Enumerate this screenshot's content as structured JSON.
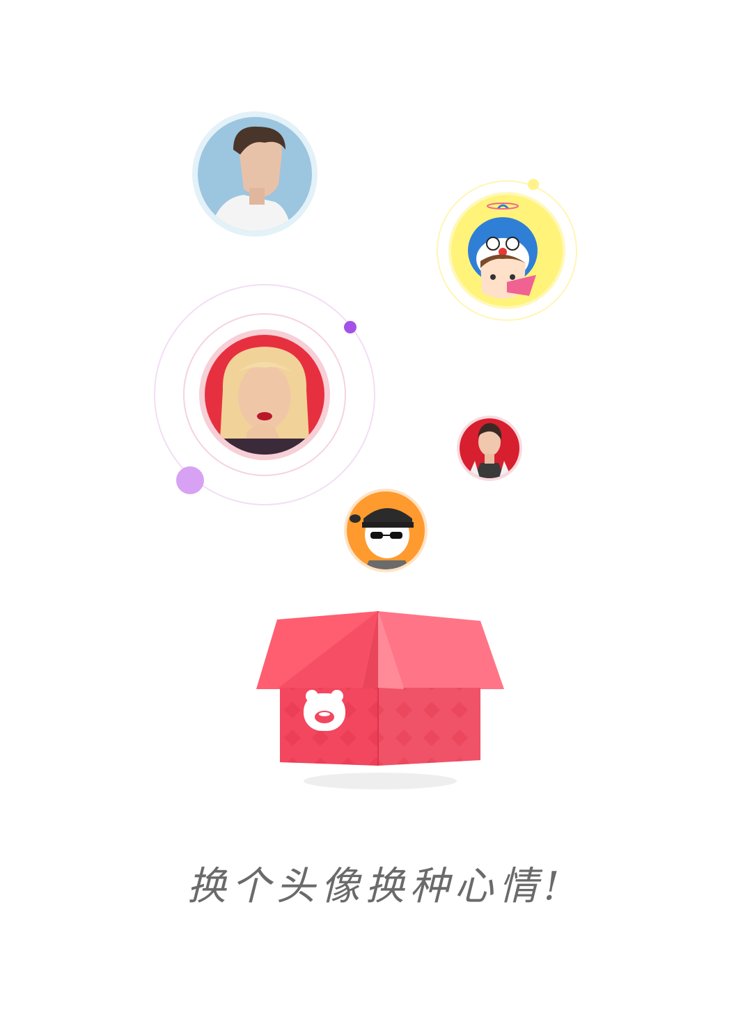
{
  "splash": {
    "slogan": "换个头像换种心情!",
    "colors": {
      "background": "#ffffff",
      "box_front": "#f2475f",
      "box_side": "#ff6f81",
      "box_lid_left": "#ff5a6c",
      "box_lid_right": "#ff7586",
      "orbit": "#f0d6f5",
      "dot_purple": "#a451e8",
      "dot_lilac": "#d7a2f4",
      "dot_yellow": "#fff38a",
      "slogan": "#6a6a6a"
    },
    "avatars": [
      {
        "name": "avatar-photo-young-man-icon",
        "ring": "#dceef7",
        "fill": "#9cc5df"
      },
      {
        "name": "avatar-cartoon-doraemon-girl-icon",
        "ring": "#fff6a8",
        "fill": "#fff37a"
      },
      {
        "name": "avatar-photo-blonde-woman-icon",
        "ring": "#f6c9d0",
        "fill": "#e7303f"
      },
      {
        "name": "avatar-photo-man-red-bg-icon",
        "ring": "#f8d6dc",
        "fill": "#d81f2f"
      },
      {
        "name": "avatar-cartoon-boy-sunglasses-icon",
        "ring": "#ffe6c8",
        "fill": "#ff9a2e"
      }
    ],
    "box_icon": "bear-face-icon"
  }
}
